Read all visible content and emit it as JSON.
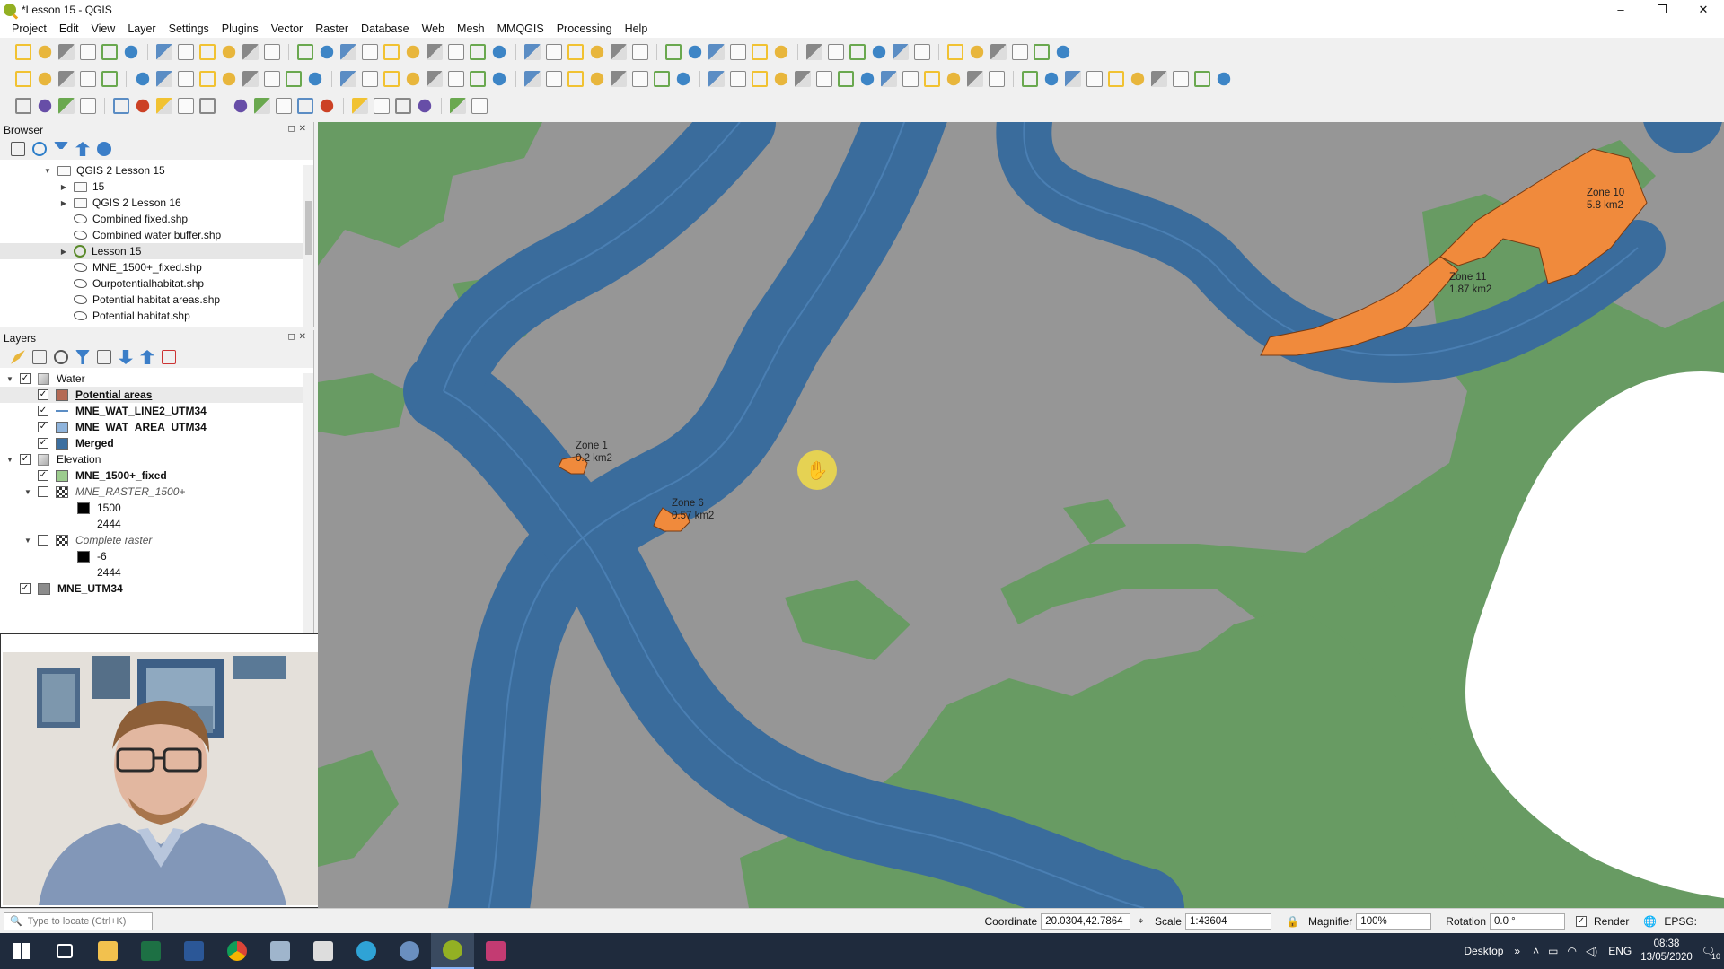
{
  "window": {
    "title": "*Lesson 15 - QGIS",
    "controls": [
      "–",
      "❐",
      "✕"
    ]
  },
  "menu": [
    "Project",
    "Edit",
    "View",
    "Layer",
    "Settings",
    "Plugins",
    "Vector",
    "Raster",
    "Database",
    "Web",
    "Mesh",
    "MMQGIS",
    "Processing",
    "Help"
  ],
  "browser": {
    "title": "Browser",
    "items": [
      {
        "label": "QGIS 2 Lesson 15",
        "type": "folder",
        "indent": 1,
        "arrow": "▼"
      },
      {
        "label": "15",
        "type": "folder",
        "indent": 2,
        "arrow": "▶"
      },
      {
        "label": "QGIS 2 Lesson 16",
        "type": "folder",
        "indent": 2,
        "arrow": "▶"
      },
      {
        "label": "Combined fixed.shp",
        "type": "shp",
        "indent": 2,
        "arrow": ""
      },
      {
        "label": "Combined water buffer.shp",
        "type": "shp",
        "indent": 2,
        "arrow": ""
      },
      {
        "label": "Lesson 15",
        "type": "qgs",
        "indent": 2,
        "arrow": "▶"
      },
      {
        "label": "MNE_1500+_fixed.shp",
        "type": "shp",
        "indent": 2,
        "arrow": ""
      },
      {
        "label": "Ourpotentialhabitat.shp",
        "type": "shp",
        "indent": 2,
        "arrow": ""
      },
      {
        "label": "Potential habitat areas.shp",
        "type": "shp",
        "indent": 2,
        "arrow": ""
      },
      {
        "label": "Potential habitat.shp",
        "type": "shp",
        "indent": 2,
        "arrow": ""
      }
    ]
  },
  "layers": {
    "title": "Layers",
    "items": [
      {
        "label": "Water",
        "kind": "group",
        "checked": true,
        "bold": false,
        "italic": false,
        "indent": 0,
        "arrow": "▼"
      },
      {
        "label": "Potential areas",
        "kind": "layer",
        "checked": true,
        "bold": true,
        "italic": false,
        "indent": 1,
        "swatch": "#b46a55",
        "underline": true
      },
      {
        "label": "MNE_WAT_LINE2_UTM34",
        "kind": "layer",
        "checked": true,
        "bold": true,
        "italic": false,
        "indent": 1,
        "swatch": "line"
      },
      {
        "label": "MNE_WAT_AREA_UTM34",
        "kind": "layer",
        "checked": true,
        "bold": true,
        "italic": false,
        "indent": 1,
        "swatch": "#8fb4dc"
      },
      {
        "label": "Merged",
        "kind": "layer",
        "checked": true,
        "bold": true,
        "italic": false,
        "indent": 1,
        "swatch": "#3c6fa0"
      },
      {
        "label": "Elevation",
        "kind": "group",
        "checked": true,
        "bold": false,
        "italic": false,
        "indent": 0,
        "arrow": "▼"
      },
      {
        "label": "MNE_1500+_fixed",
        "kind": "layer",
        "checked": true,
        "bold": true,
        "italic": false,
        "indent": 1,
        "swatch": "#9ccc8e"
      },
      {
        "label": "MNE_RASTER_1500+",
        "kind": "raster",
        "checked": false,
        "bold": false,
        "italic": true,
        "indent": 1,
        "arrow": "▼"
      },
      {
        "label": "1500",
        "kind": "legend",
        "indent": 2,
        "swatch": "#000000"
      },
      {
        "label": "2444",
        "kind": "legend",
        "indent": 2,
        "swatch": "none"
      },
      {
        "label": "Complete raster",
        "kind": "raster",
        "checked": false,
        "bold": false,
        "italic": true,
        "indent": 1,
        "arrow": "▼"
      },
      {
        "label": "-6",
        "kind": "legend",
        "indent": 2,
        "swatch": "#000000"
      },
      {
        "label": "2444",
        "kind": "legend",
        "indent": 2,
        "swatch": "none"
      },
      {
        "label": "MNE_UTM34",
        "kind": "layer",
        "checked": true,
        "bold": true,
        "italic": false,
        "indent": 0,
        "swatch": "#8c8c8c"
      }
    ]
  },
  "map": {
    "colors": {
      "background": "#969696",
      "water": "#3a6c9c",
      "waterLine": "#4a7fb3",
      "elevation": "#689b63",
      "potential": "#f08a3c",
      "hole": "#ffffff"
    },
    "labels": [
      {
        "name": "Zone 10",
        "area": "5.8 km2"
      },
      {
        "name": "Zone 11",
        "area": "1.87 km2"
      },
      {
        "name": "Zone 1",
        "area": "0.2 km2"
      },
      {
        "name": "Zone 6",
        "area": "0.57 km2"
      }
    ],
    "cursor": "pan-hand"
  },
  "status": {
    "locator_placeholder": "Type to locate (Ctrl+K)",
    "coordinate_label": "Coordinate",
    "coordinate_value": "20.0304,42.7864",
    "scale_label": "Scale",
    "scale_value": "1:43604",
    "magnifier_label": "Magnifier",
    "magnifier_value": "100%",
    "rotation_label": "Rotation",
    "rotation_value": "0.0 °",
    "render_label": "Render",
    "crs": "EPSG:"
  },
  "taskbar": {
    "desktop_label": "Desktop",
    "language": "ENG",
    "time": "08:38",
    "date": "13/05/2020",
    "notification_count": "10"
  }
}
